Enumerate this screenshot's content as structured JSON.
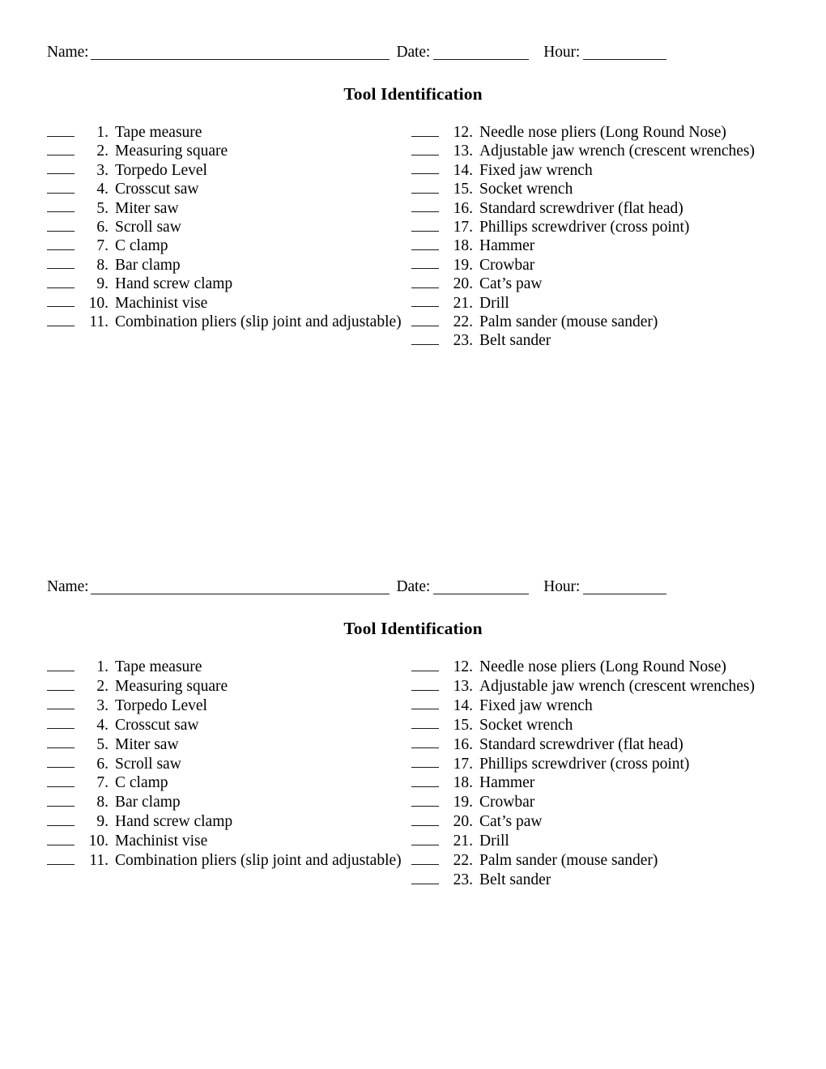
{
  "document": {
    "title": "Tool Identification",
    "copies": 2
  },
  "header": {
    "name_label": "Name:",
    "date_label": "Date:",
    "hour_label": "Hour:",
    "name_value": "",
    "date_value": "",
    "hour_value": ""
  },
  "list": {
    "left_column": [
      {
        "number": "1.",
        "label": "Tape measure"
      },
      {
        "number": "2.",
        "label": "Measuring square"
      },
      {
        "number": "3.",
        "label": "Torpedo Level"
      },
      {
        "number": "4.",
        "label": "Crosscut saw"
      },
      {
        "number": "5.",
        "label": "Miter saw"
      },
      {
        "number": "6.",
        "label": "Scroll saw"
      },
      {
        "number": "7.",
        "label": "C clamp"
      },
      {
        "number": "8.",
        "label": "Bar clamp"
      },
      {
        "number": "9.",
        "label": "Hand screw clamp"
      },
      {
        "number": "10.",
        "label": "Machinist vise"
      },
      {
        "number": "11.",
        "label": "Combination pliers (slip joint and adjustable)"
      }
    ],
    "right_column": [
      {
        "number": "12.",
        "label": "Needle nose pliers (Long Round Nose)"
      },
      {
        "number": "13.",
        "label": "Adjustable jaw wrench (crescent wrenches)"
      },
      {
        "number": "14.",
        "label": "Fixed jaw wrench"
      },
      {
        "number": "15.",
        "label": "Socket wrench"
      },
      {
        "number": "16.",
        "label": "Standard screwdriver (flat head)"
      },
      {
        "number": "17.",
        "label": "Phillips screwdriver (cross point)"
      },
      {
        "number": "18.",
        "label": "Hammer"
      },
      {
        "number": "19.",
        "label": "Crowbar"
      },
      {
        "number": "20.",
        "label": "Cat’s paw"
      },
      {
        "number": "21.",
        "label": "Drill"
      },
      {
        "number": "22.",
        "label": "Palm sander (mouse sander)"
      },
      {
        "number": "23.",
        "label": "Belt sander"
      }
    ]
  },
  "colors": {
    "page_background": "#ffffff",
    "text": "#000000",
    "rule_line": "#1a1a1a"
  }
}
